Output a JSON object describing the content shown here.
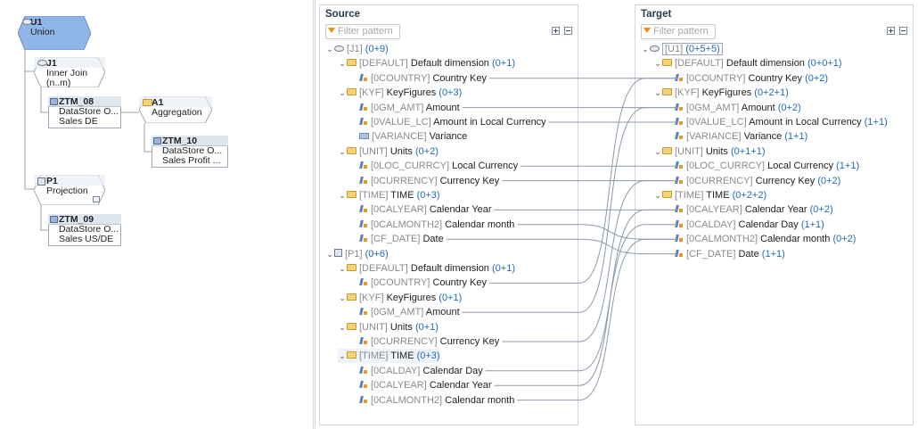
{
  "diagram": {
    "nodes": [
      {
        "key": "u1",
        "name": "U1",
        "sub": "Union",
        "kind": "union"
      },
      {
        "key": "j1",
        "name": "J1",
        "sub": "Inner Join",
        "sub2": "(n..m)",
        "kind": "join"
      },
      {
        "key": "ztm08",
        "name": "ZTM_08",
        "sub": "DataStore O...",
        "sub2": "Sales DE",
        "kind": "ds"
      },
      {
        "key": "a1",
        "name": "A1",
        "sub": "Aggregation",
        "kind": "agg"
      },
      {
        "key": "ztm10",
        "name": "ZTM_10",
        "sub": "DataStore O...",
        "sub2": "Sales Profit ...",
        "kind": "ds"
      },
      {
        "key": "p1",
        "name": "P1",
        "sub": "Projection",
        "kind": "proj"
      },
      {
        "key": "ztm09",
        "name": "ZTM_09",
        "sub": "DataStore O...",
        "sub2": "Sales US/DE",
        "kind": "ds"
      }
    ]
  },
  "source": {
    "title": "Source",
    "filter_placeholder": "Filter pattern",
    "rows": [
      {
        "level": 0,
        "arrow": "v",
        "icon": "view",
        "tech": "[J1]",
        "name": "",
        "count": "(0+9)"
      },
      {
        "level": 1,
        "arrow": "v",
        "icon": "folder",
        "tech": "[DEFAULT]",
        "name": "Default dimension",
        "count": "(0+1)"
      },
      {
        "level": 2,
        "arrow": "",
        "icon": "attr",
        "tech": "[0COUNTRY]",
        "name": "Country Key",
        "count": ""
      },
      {
        "level": 1,
        "arrow": "v",
        "icon": "folder",
        "tech": "[KYF]",
        "name": "KeyFigures",
        "count": "(0+3)"
      },
      {
        "level": 2,
        "arrow": "",
        "icon": "attr",
        "tech": "[0GM_AMT]",
        "name": "Amount",
        "count": ""
      },
      {
        "level": 2,
        "arrow": "",
        "icon": "attr",
        "tech": "[0VALUE_LC]",
        "name": "Amount in Local Currency",
        "count": ""
      },
      {
        "level": 2,
        "arrow": "",
        "icon": "var",
        "tech": "[VARIANCE]",
        "name": "Variance",
        "count": ""
      },
      {
        "level": 1,
        "arrow": "v",
        "icon": "folder",
        "tech": "[UNIT]",
        "name": "Units",
        "count": "(0+2)"
      },
      {
        "level": 2,
        "arrow": "",
        "icon": "attr",
        "tech": "[0LOC_CURRCY]",
        "name": "Local Currency",
        "count": ""
      },
      {
        "level": 2,
        "arrow": "",
        "icon": "attr",
        "tech": "[0CURRENCY]",
        "name": "Currency Key",
        "count": ""
      },
      {
        "level": 1,
        "arrow": "v",
        "icon": "folder",
        "tech": "[TIME]",
        "name": "TIME",
        "count": "(0+3)"
      },
      {
        "level": 2,
        "arrow": "",
        "icon": "attr",
        "tech": "[0CALYEAR]",
        "name": "Calendar Year",
        "count": ""
      },
      {
        "level": 2,
        "arrow": "",
        "icon": "attr",
        "tech": "[0CALMONTH2]",
        "name": "Calendar month",
        "count": ""
      },
      {
        "level": 2,
        "arrow": "",
        "icon": "attr",
        "tech": "[CF_DATE]",
        "name": "Date",
        "count": ""
      },
      {
        "level": 0,
        "arrow": "v",
        "icon": "proj",
        "tech": "[P1]",
        "name": "",
        "count": "(0+6)"
      },
      {
        "level": 1,
        "arrow": "v",
        "icon": "folder",
        "tech": "[DEFAULT]",
        "name": "Default dimension",
        "count": "(0+1)"
      },
      {
        "level": 2,
        "arrow": "",
        "icon": "attr",
        "tech": "[0COUNTRY]",
        "name": "Country Key",
        "count": ""
      },
      {
        "level": 1,
        "arrow": "v",
        "icon": "folder",
        "tech": "[KYF]",
        "name": "KeyFigures",
        "count": "(0+1)"
      },
      {
        "level": 2,
        "arrow": "",
        "icon": "attr",
        "tech": "[0GM_AMT]",
        "name": "Amount",
        "count": ""
      },
      {
        "level": 1,
        "arrow": "v",
        "icon": "folder",
        "tech": "[UNIT]",
        "name": "Units",
        "count": "(0+1)"
      },
      {
        "level": 2,
        "arrow": "",
        "icon": "attr",
        "tech": "[0CURRENCY]",
        "name": "Currency Key",
        "count": ""
      },
      {
        "level": 1,
        "arrow": "v",
        "icon": "folder",
        "tech": "[TIME]",
        "name": "TIME",
        "count": "(0+3)",
        "highlight": true
      },
      {
        "level": 2,
        "arrow": "",
        "icon": "attr",
        "tech": "[0CALDAY]",
        "name": "Calendar Day",
        "count": ""
      },
      {
        "level": 2,
        "arrow": "",
        "icon": "attr",
        "tech": "[0CALYEAR]",
        "name": "Calendar Year",
        "count": ""
      },
      {
        "level": 2,
        "arrow": "",
        "icon": "attr",
        "tech": "[0CALMONTH2]",
        "name": "Calendar month",
        "count": ""
      }
    ]
  },
  "target": {
    "title": "Target",
    "filter_placeholder": "Filter pattern",
    "rows": [
      {
        "level": 0,
        "arrow": "v",
        "icon": "view",
        "tech": "[U1]",
        "name": "",
        "count": "(0+5+5)",
        "selected": true
      },
      {
        "level": 1,
        "arrow": "v",
        "icon": "folder",
        "tech": "[DEFAULT]",
        "name": "Default dimension",
        "count": "(0+0+1)"
      },
      {
        "level": 2,
        "arrow": "",
        "icon": "attr",
        "tech": "[0COUNTRY]",
        "name": "Country Key",
        "count": "(0+2)"
      },
      {
        "level": 1,
        "arrow": "v",
        "icon": "folder",
        "tech": "[KYF]",
        "name": "KeyFigures",
        "count": "(0+2+1)"
      },
      {
        "level": 2,
        "arrow": "",
        "icon": "attr",
        "tech": "[0GM_AMT]",
        "name": "Amount",
        "count": "(0+2)"
      },
      {
        "level": 2,
        "arrow": "",
        "icon": "attr",
        "tech": "[0VALUE_LC]",
        "name": "Amount in Local Currency",
        "count": "(1+1)"
      },
      {
        "level": 2,
        "arrow": "",
        "icon": "attr",
        "tech": "[VARIANCE]",
        "name": "Variance",
        "count": "(1+1)"
      },
      {
        "level": 1,
        "arrow": "v",
        "icon": "folder",
        "tech": "[UNIT]",
        "name": "Units",
        "count": "(0+1+1)"
      },
      {
        "level": 2,
        "arrow": "",
        "icon": "attr",
        "tech": "[0LOC_CURRCY]",
        "name": "Local Currency",
        "count": "(1+1)"
      },
      {
        "level": 2,
        "arrow": "",
        "icon": "attr",
        "tech": "[0CURRENCY]",
        "name": "Currency Key",
        "count": "(0+2)"
      },
      {
        "level": 1,
        "arrow": "v",
        "icon": "folder",
        "tech": "[TIME]",
        "name": "TIME",
        "count": "(0+2+2)"
      },
      {
        "level": 2,
        "arrow": "",
        "icon": "attr",
        "tech": "[0CALYEAR]",
        "name": "Calendar Year",
        "count": "(0+2)"
      },
      {
        "level": 2,
        "arrow": "",
        "icon": "attr",
        "tech": "[0CALDAY]",
        "name": "Calendar Day",
        "count": "(1+1)"
      },
      {
        "level": 2,
        "arrow": "",
        "icon": "attr",
        "tech": "[0CALMONTH2]",
        "name": "Calendar month",
        "count": "(0+2)"
      },
      {
        "level": 2,
        "arrow": "",
        "icon": "attr",
        "tech": "[CF_DATE]",
        "name": "Date",
        "count": "(1+1)"
      }
    ]
  },
  "mappings": [
    [
      2,
      2
    ],
    [
      4,
      4
    ],
    [
      5,
      5
    ],
    [
      8,
      8
    ],
    [
      9,
      9
    ],
    [
      11,
      11
    ],
    [
      12,
      13
    ],
    [
      13,
      14
    ],
    [
      16,
      2
    ],
    [
      18,
      4
    ],
    [
      20,
      9
    ],
    [
      22,
      12
    ],
    [
      23,
      11
    ],
    [
      24,
      13
    ]
  ],
  "colors": {
    "union_fill": "#8fb6e6",
    "accent": "#1f6bb5",
    "line": "#8c9aaa"
  }
}
